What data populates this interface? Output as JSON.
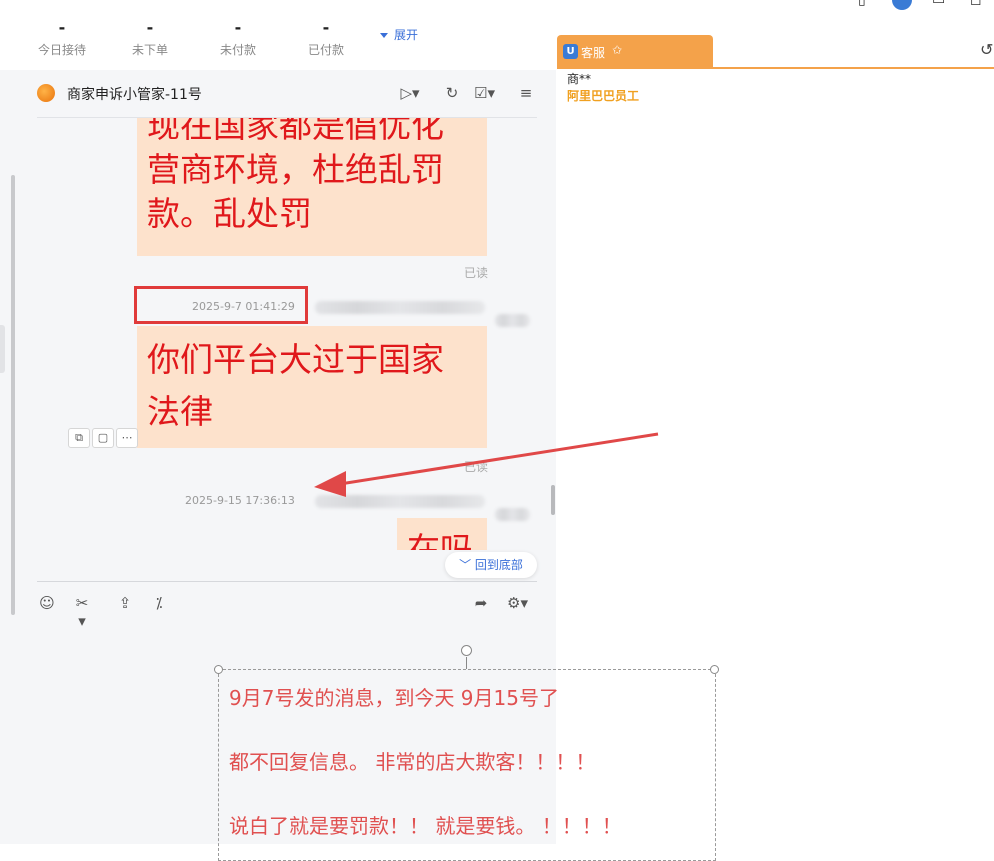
{
  "stats": [
    {
      "value": "-",
      "label": "今日接待"
    },
    {
      "value": "-",
      "label": "未下单"
    },
    {
      "value": "-",
      "label": "未付款"
    },
    {
      "value": "-",
      "label": "已付款"
    }
  ],
  "expand_label": "展开",
  "chat": {
    "title": "商家申诉小管家-11号",
    "messages": {
      "m1_line1": "现在国家都是倡优化",
      "m1_line2": "营商环境，杜绝乱罚",
      "m1_line3": "款。乱处罚",
      "read1": "已读",
      "time1": "2025-9-7 01:41:29",
      "m2_line1": "你们平台大过于国家",
      "m2_line2": "法律",
      "read2": "已读",
      "time2": "2025-9-15 17:36:13",
      "m3_line1": "在吗"
    },
    "back_to_bottom": "回到底部"
  },
  "right_panel": {
    "tab_label": "客服",
    "customer_name": "商**",
    "customer_org": "阿里巴巴员工"
  },
  "annotation": {
    "line1": "9月7号发的消息，到今天 9月15号了",
    "line2": "都不回复信息。 非常的店大欺客！！！！",
    "line3": "说白了就是要罚款！！ 就是要钱。  ！！！！"
  },
  "colors": {
    "accent": "#f4a24a",
    "bubble_bg": "#fde2cc",
    "bubble_text": "#e0181b",
    "annotation_text": "#e05050",
    "link_blue": "#3a6fd8"
  }
}
